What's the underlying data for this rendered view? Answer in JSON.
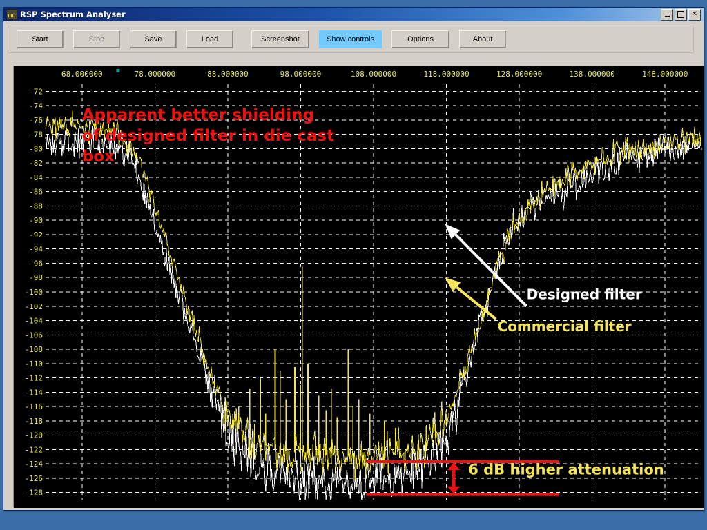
{
  "window": {
    "title": "RSP Spectrum Analyser",
    "icon": "spectrum-app-icon",
    "minimize_label": "_",
    "maximize_label": "□",
    "close_label": "✕"
  },
  "toolbar": {
    "buttons": [
      {
        "label": "Start",
        "name": "start-button",
        "state": "normal"
      },
      {
        "label": "Stop",
        "name": "stop-button",
        "state": "disabled"
      },
      {
        "label": "Save",
        "name": "save-button",
        "state": "normal"
      },
      {
        "label": "Load",
        "name": "load-button",
        "state": "normal"
      },
      {
        "label": "Screenshot",
        "name": "screenshot-button",
        "state": "normal"
      },
      {
        "label": "Show controls",
        "name": "show-controls-button",
        "state": "active"
      },
      {
        "label": "Options",
        "name": "options-button",
        "state": "normal"
      },
      {
        "label": "About",
        "name": "about-button",
        "state": "normal"
      }
    ]
  },
  "colors": {
    "plot_background": "#000000",
    "grid": "#ffffff",
    "axis_text": "#e8e86a",
    "trace_designed": "#ffffff",
    "trace_commercial": "#f2e63c",
    "annotation_red": "#ee1111",
    "annotation_yellow": "#f5e55a",
    "annotation_white": "#ffffff",
    "titlebar": "#0a246a",
    "accent_active": "#73caff"
  },
  "chart_data": {
    "type": "line",
    "title": "",
    "xlabel": "",
    "ylabel": "",
    "xlim": [
      63.0,
      153.0
    ],
    "ylim": [
      -129.0,
      -71.0
    ],
    "grid": true,
    "legend_position": "in-plot-annotations",
    "x_tick_labels": [
      "68.000000",
      "78.000000",
      "88.000000",
      "98.000000",
      "108.000000",
      "118.000000",
      "128.000000",
      "138.000000",
      "148.000000"
    ],
    "x_tick_values": [
      68,
      78,
      88,
      98,
      108,
      118,
      128,
      138,
      148
    ],
    "y_tick_labels": [
      "-72",
      "-74",
      "-76",
      "-78",
      "-80",
      "-82",
      "-84",
      "-86",
      "-88",
      "-90",
      "-92",
      "-94",
      "-96",
      "-98",
      "-100",
      "-102",
      "-104",
      "-106",
      "-108",
      "-110",
      "-112",
      "-114",
      "-116",
      "-118",
      "-120",
      "-122",
      "-124",
      "-126",
      "-128"
    ],
    "y_tick_values": [
      -72,
      -74,
      -76,
      -78,
      -80,
      -82,
      -84,
      -86,
      -88,
      -90,
      -92,
      -94,
      -96,
      -98,
      -100,
      -102,
      -104,
      -106,
      -108,
      -110,
      -112,
      -114,
      -116,
      -118,
      -120,
      -122,
      -124,
      -126,
      -128
    ],
    "series": [
      {
        "name": "Designed filter",
        "color": "#ffffff",
        "noise_amplitude": 2.2,
        "seed": 1337,
        "x": [
          63,
          64,
          65,
          66,
          67,
          68,
          69,
          70,
          71,
          72,
          73,
          74,
          75,
          76,
          77,
          78,
          79,
          80,
          81,
          82,
          83,
          84,
          85,
          86,
          87,
          88,
          89,
          90,
          91,
          92,
          93,
          94,
          95,
          96,
          97,
          98,
          99,
          100,
          101,
          102,
          103,
          104,
          105,
          106,
          107,
          108,
          109,
          110,
          111,
          112,
          113,
          114,
          115,
          116,
          117,
          118,
          119,
          120,
          121,
          122,
          123,
          124,
          125,
          126,
          127,
          128,
          129,
          130,
          131,
          132,
          133,
          134,
          135,
          136,
          137,
          138,
          139,
          140,
          141,
          142,
          143,
          144,
          145,
          146,
          147,
          148,
          149,
          150,
          151,
          152,
          153
        ],
        "y": [
          -78.5,
          -79.2,
          -79.6,
          -79.4,
          -79.1,
          -79.0,
          -78.8,
          -79.0,
          -79.3,
          -79.6,
          -80.0,
          -80.6,
          -82.0,
          -84.5,
          -87.5,
          -90.5,
          -93.5,
          -96.5,
          -99.5,
          -102.5,
          -105.5,
          -108.5,
          -111.5,
          -114.5,
          -117.0,
          -119.0,
          -120.8,
          -122.0,
          -123.0,
          -123.8,
          -124.4,
          -124.8,
          -125.2,
          -125.5,
          -125.8,
          -126.0,
          -126.1,
          -126.3,
          -126.4,
          -126.5,
          -126.5,
          -126.6,
          -126.6,
          -126.6,
          -126.5,
          -126.4,
          -126.3,
          -126.2,
          -126.0,
          -125.7,
          -125.3,
          -124.8,
          -124.0,
          -123.0,
          -121.5,
          -119.5,
          -117.0,
          -114.0,
          -110.5,
          -107.0,
          -103.5,
          -100.0,
          -96.5,
          -93.5,
          -91.0,
          -89.5,
          -88.8,
          -88.2,
          -87.6,
          -87.0,
          -86.4,
          -85.8,
          -85.2,
          -84.6,
          -84.0,
          -83.4,
          -82.8,
          -82.4,
          -82.0,
          -81.6,
          -81.3,
          -81.0,
          -80.8,
          -80.6,
          -80.4,
          -80.3,
          -80.2,
          -80.1,
          -80.0,
          -79.9,
          -79.8
        ]
      },
      {
        "name": "Commercial filter",
        "color": "#f2e63c",
        "noise_amplitude": 1.8,
        "seed": 4242,
        "x": [
          63,
          64,
          65,
          66,
          67,
          68,
          69,
          70,
          71,
          72,
          73,
          74,
          75,
          76,
          77,
          78,
          79,
          80,
          81,
          82,
          83,
          84,
          85,
          86,
          87,
          88,
          89,
          90,
          91,
          92,
          93,
          94,
          95,
          96,
          97,
          98,
          99,
          100,
          101,
          102,
          103,
          104,
          105,
          106,
          107,
          108,
          109,
          110,
          111,
          112,
          113,
          114,
          115,
          116,
          117,
          118,
          119,
          120,
          121,
          122,
          123,
          124,
          125,
          126,
          127,
          128,
          129,
          130,
          131,
          132,
          133,
          134,
          135,
          136,
          137,
          138,
          139,
          140,
          141,
          142,
          143,
          144,
          145,
          146,
          147,
          148,
          149,
          150,
          151,
          152,
          153
        ],
        "y": [
          -76.8,
          -77.0,
          -77.2,
          -77.1,
          -77.0,
          -76.9,
          -77.0,
          -77.1,
          -77.3,
          -77.6,
          -78.0,
          -78.6,
          -80.0,
          -82.5,
          -85.5,
          -88.5,
          -91.5,
          -94.5,
          -97.5,
          -100.5,
          -103.5,
          -106.5,
          -109.5,
          -112.5,
          -115.0,
          -117.0,
          -118.6,
          -119.6,
          -120.4,
          -121.0,
          -121.4,
          -121.7,
          -122.0,
          -122.2,
          -122.4,
          -122.5,
          -122.6,
          -122.7,
          -122.8,
          -122.8,
          -122.9,
          -122.9,
          -122.9,
          -122.9,
          -122.8,
          -122.8,
          -122.7,
          -122.6,
          -122.5,
          -122.3,
          -122.0,
          -121.6,
          -121.0,
          -120.2,
          -119.0,
          -117.4,
          -115.2,
          -112.5,
          -109.5,
          -106.2,
          -103.0,
          -99.8,
          -96.6,
          -93.8,
          -91.4,
          -89.6,
          -88.4,
          -87.4,
          -86.6,
          -85.8,
          -85.0,
          -84.3,
          -83.7,
          -83.1,
          -82.5,
          -82.0,
          -81.5,
          -81.1,
          -80.7,
          -80.4,
          -80.1,
          -79.9,
          -79.7,
          -79.5,
          -79.4,
          -79.3,
          -79.2,
          -79.1,
          -79.0,
          -78.9,
          -78.8
        ]
      }
    ],
    "spikes_commercial": [
      {
        "x": 98.2,
        "top": -96.5
      },
      {
        "x": 98.0,
        "top": -113.0
      },
      {
        "x": 96.0,
        "top": -115.0
      },
      {
        "x": 94.5,
        "top": -108.0
      },
      {
        "x": 92.5,
        "top": -112.0
      },
      {
        "x": 91.0,
        "top": -113.5
      },
      {
        "x": 89.5,
        "top": -116.0
      },
      {
        "x": 100.5,
        "top": -114.5
      },
      {
        "x": 101.5,
        "top": -116.5
      },
      {
        "x": 103.0,
        "top": -117.5
      },
      {
        "x": 104.5,
        "top": -108.0
      },
      {
        "x": 106.0,
        "top": -115.0
      },
      {
        "x": 107.5,
        "top": -117.0
      },
      {
        "x": 109.5,
        "top": -118.0
      },
      {
        "x": 111.0,
        "top": -119.0
      },
      {
        "x": 99.0,
        "top": -110.0
      },
      {
        "x": 97.2,
        "top": -110.5
      },
      {
        "x": 95.2,
        "top": -111.0
      },
      {
        "x": 93.2,
        "top": -117.0
      },
      {
        "x": 102.2,
        "top": -113.5
      },
      {
        "x": 105.2,
        "top": -116.0
      }
    ],
    "annotations": [
      {
        "name": "shielding-note",
        "text": "Apparent better shielding\nof designed filter in die cast\nbox",
        "color": "#ee1111",
        "x": 68.0,
        "y": -76.0
      },
      {
        "name": "designed-filter-label",
        "text": "Designed filter",
        "color": "#ffffff",
        "x": 129.0,
        "y": -101.0
      },
      {
        "name": "commercial-filter-label",
        "text": "Commercial filter",
        "color": "#f5e55a",
        "x": 125.0,
        "y": -105.5
      },
      {
        "name": "attenuation-note",
        "text": "6 dB higher attenuation",
        "color": "#f5e55a",
        "x": 121.0,
        "y": -125.5
      }
    ],
    "arrows": [
      {
        "name": "designed-filter-arrow",
        "color": "#ffffff",
        "from_x": 129.0,
        "from_y": -102.0,
        "to_x": 117.8,
        "to_y": -90.5
      },
      {
        "name": "commercial-filter-arrow",
        "color": "#f5e55a",
        "from_x": 124.8,
        "from_y": -103.8,
        "to_x": 117.8,
        "to_y": -98.0
      }
    ],
    "measure": {
      "name": "attenuation-marker",
      "label": "6 dB higher attenuation",
      "value_db": 6,
      "color": "#ee1111",
      "upper_y": -123.7,
      "lower_y": -128.3,
      "line_x_start": 107.0,
      "line_x_end": 133.5,
      "arrow_x": 119.0
    }
  }
}
